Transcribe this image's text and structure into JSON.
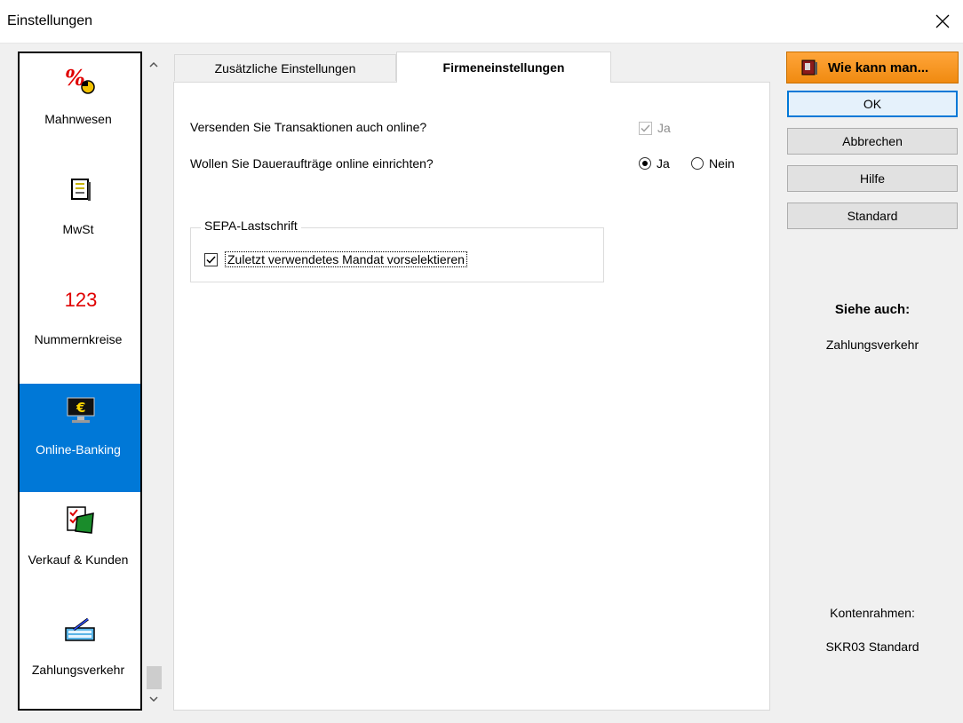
{
  "window": {
    "title": "Einstellungen"
  },
  "nav": {
    "items": [
      {
        "label": "Mahnwesen",
        "icon": "percent-icon"
      },
      {
        "label": "MwSt",
        "icon": "document-icon"
      },
      {
        "label": "Nummernkreise",
        "icon": "numbers-icon",
        "icon_text": "123"
      },
      {
        "label": "Online-Banking",
        "icon": "euro-monitor-icon",
        "active": true
      },
      {
        "label": "Verkauf & Kunden",
        "icon": "checklist-icon"
      },
      {
        "label": "Zahlungsverkehr",
        "icon": "keyboard-pen-icon"
      }
    ]
  },
  "tabs": [
    {
      "label": "Zusätzliche Einstellungen"
    },
    {
      "label": "Firmeneinstellungen",
      "active": true
    }
  ],
  "panel": {
    "q1": "Versenden Sie Transaktionen auch online?",
    "q1_check_label": "Ja",
    "q2": "Wollen Sie Daueraufträge online einrichten?",
    "q2_yes": "Ja",
    "q2_no": "Nein",
    "group_title": "SEPA-Lastschrift",
    "group_check_label": "Zuletzt verwendetes Mandat vorselektieren"
  },
  "side": {
    "help_label": "Wie kann man...",
    "ok": "OK",
    "cancel": "Abbrechen",
    "help": "Hilfe",
    "standard": "Standard",
    "see_also_title": "Siehe auch:",
    "see_also_link": "Zahlungsverkehr",
    "chart_label": "Kontenrahmen:",
    "chart_value": "SKR03 Standard"
  },
  "colors": {
    "accent": "#0078d7",
    "help_orange": "#f59a23",
    "numbers_red": "#e00000"
  }
}
